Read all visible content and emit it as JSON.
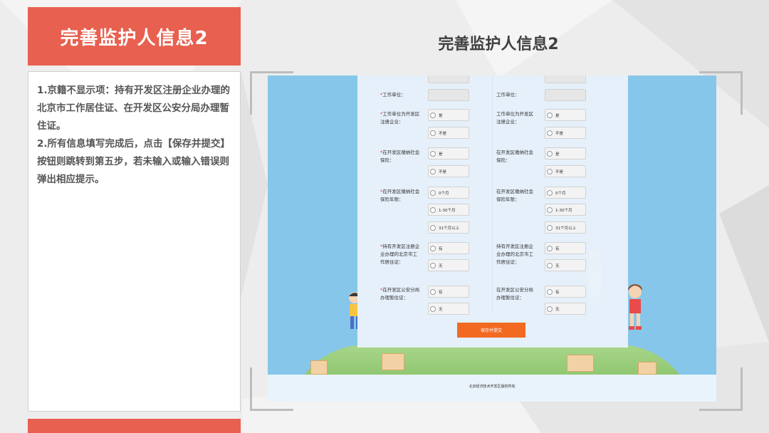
{
  "left_panel": {
    "header_title": "完善监护人信息2",
    "paragraphs": [
      "1.京籍不显示项：持有开发区注册企业办理的北京市工作居住证、在开发区公安分局办理暂住证。",
      "2.所有信息填写完成后，点击【保存并提交】按钮则跳转到第五步，若未输入或输入错误则弹出相应提示。"
    ]
  },
  "slide_title": "完善监护人信息2",
  "form": {
    "left_col": {
      "work_unit": "工作单位：",
      "q_registered": [
        "工作单位为开发区",
        "注册企业："
      ],
      "q_insurance": [
        "在开发区缴纳社会",
        "保险："
      ],
      "q_insurance_years": [
        "在开发区缴纳社会",
        "保险年限："
      ],
      "q_residence_permit": [
        "持有开发区注册企",
        "业办理的北京市工",
        "作居住证："
      ],
      "q_temp_permit": [
        "在开发区公安分局",
        "办理暂住证："
      ]
    },
    "right_col": {
      "work_unit": "工作单位：",
      "q_registered": [
        "工作单位为开发区",
        "注册企业："
      ],
      "q_insurance": [
        "在开发区缴纳社会",
        "保险："
      ],
      "q_insurance_years": [
        "在开发区缴纳社会",
        "保险年限："
      ],
      "q_residence_permit": [
        "持有开发区注册企",
        "业办理的北京市工",
        "作居住证："
      ],
      "q_temp_permit": [
        "在开发区公安分局",
        "办理暂住证："
      ]
    },
    "options": {
      "yes_is": "是",
      "no_is": "不是",
      "years_0": "0个月",
      "years_1": "1-30个月",
      "years_2": "31个月以上",
      "have": "有",
      "none": "无"
    },
    "save_button": "保存并提交",
    "copyright": "北京经济技术开发区版权所有"
  }
}
